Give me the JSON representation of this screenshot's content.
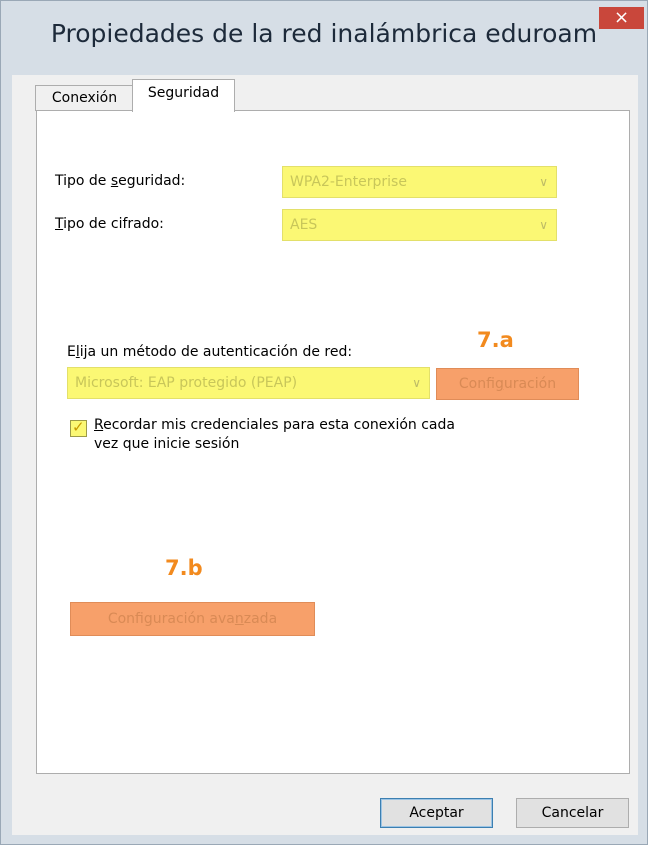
{
  "window": {
    "title": "Propiedades de la red inalámbrica eduroam",
    "close_glyph": "×"
  },
  "tabs": [
    {
      "label": "Conexión",
      "selected": false
    },
    {
      "label": "Seguridad",
      "selected": true
    }
  ],
  "security": {
    "type_label_pre": "Tipo de ",
    "type_label_key": "s",
    "type_label_post": "eguridad:",
    "type_value": "WPA2-Enterprise",
    "cipher_label_key": "T",
    "cipher_label_post": "ipo de cifrado:",
    "cipher_value": "AES"
  },
  "auth": {
    "label_pre": "E",
    "label_key": "l",
    "label_post": "ija un método de autenticación de red:",
    "method_value": "Microsoft: EAP protegido (PEAP)",
    "config_pre": "Confi",
    "config_key": "g",
    "config_post": "uración",
    "remember_key": "R",
    "remember_line1_post": "ecordar mis credenciales para esta conexión cada",
    "remember_line2": "vez que inicie sesión",
    "remember_checked": true
  },
  "advanced": {
    "pre": "Configuración ava",
    "key": "n",
    "post": "zada"
  },
  "annotations": {
    "step_a": "7.a",
    "step_b": "7.b"
  },
  "footer": {
    "ok_label": "Aceptar",
    "cancel_label": "Cancelar"
  },
  "colors": {
    "highlight_yellow": "#fbf874",
    "highlight_orange": "#f7a06a",
    "annotation_orange": "#f28a1e",
    "close_red": "#c9473b"
  },
  "icons": {
    "close": "close-icon",
    "dropdown": "chevron-down-icon",
    "checkbox": "checkmark-icon"
  }
}
